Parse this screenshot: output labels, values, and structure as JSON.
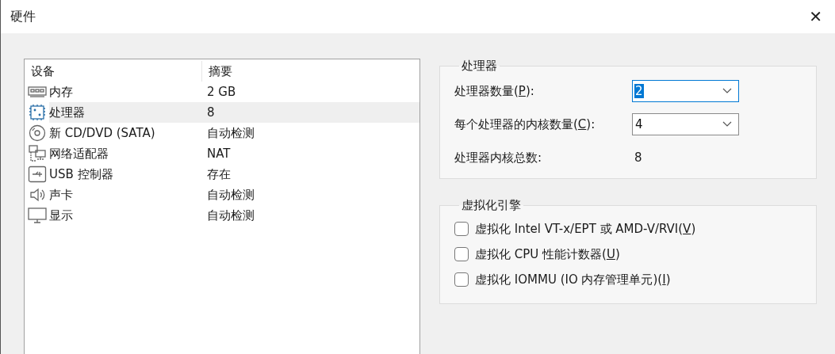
{
  "window": {
    "title": "硬件",
    "close": "✕"
  },
  "device_list": {
    "columns": [
      "设备",
      "摘要"
    ],
    "rows": [
      {
        "kind": "memory",
        "device": "内存",
        "summary": "2 GB",
        "selected": false
      },
      {
        "kind": "cpu",
        "device": "处理器",
        "summary": "8",
        "selected": true
      },
      {
        "kind": "disc",
        "device": "新 CD/DVD (SATA)",
        "summary": "自动检测",
        "selected": false
      },
      {
        "kind": "network",
        "device": "网络适配器",
        "summary": "NAT",
        "selected": false
      },
      {
        "kind": "usb",
        "device": "USB 控制器",
        "summary": "存在",
        "selected": false
      },
      {
        "kind": "sound",
        "device": "声卡",
        "summary": "自动检测",
        "selected": false
      },
      {
        "kind": "display",
        "device": "显示",
        "summary": "自动检测",
        "selected": false
      }
    ]
  },
  "processor_group": {
    "title": "处理器",
    "fields": [
      {
        "kind": "select",
        "before": "处理器数量(",
        "key": "P",
        "after": "):",
        "value": "2",
        "focused": true
      },
      {
        "kind": "select",
        "before": "每个处理器的内核数量(",
        "key": "C",
        "after": "):",
        "value": "4",
        "focused": false
      },
      {
        "kind": "readout",
        "before": "处理器内核总数:",
        "value": "8"
      }
    ]
  },
  "virtualization_group": {
    "title": "虚拟化引擎",
    "options": [
      {
        "before": "虚拟化 Intel VT-x/EPT 或 AMD-V/RVI(",
        "key": "V",
        "after": ")",
        "checked": false
      },
      {
        "before": "虚拟化 CPU 性能计数器(",
        "key": "U",
        "after": ")",
        "checked": false
      },
      {
        "before": "虚拟化 IOMMU (IO 内存管理单元)(",
        "key": "I",
        "after": ")",
        "checked": false
      }
    ]
  }
}
